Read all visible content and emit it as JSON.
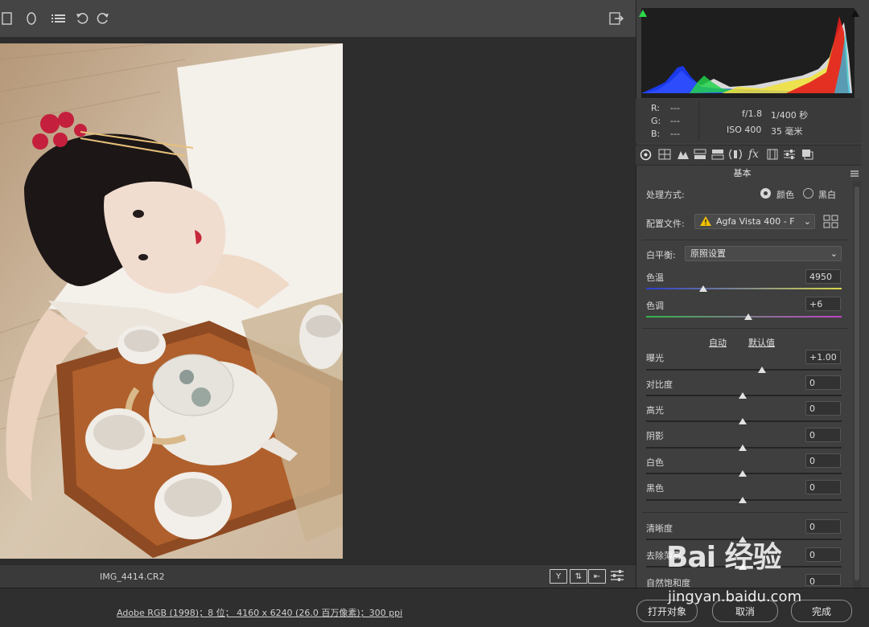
{
  "toolbar": {
    "icons": [
      "rect-icon",
      "ellipse-icon",
      "list-icon",
      "rotate-left-icon",
      "rotate-right-icon",
      "export-icon"
    ]
  },
  "preview": {
    "filename": "IMG_4414.CR2"
  },
  "info": {
    "r_label": "R:",
    "r_value": "---",
    "g_label": "G:",
    "g_value": "---",
    "b_label": "B:",
    "b_value": "---",
    "aperture": "f/1.8",
    "shutter": "1/400 秒",
    "iso": "ISO 400",
    "focal": "35 毫米"
  },
  "panel": {
    "title": "基本",
    "treatment_label": "处理方式:",
    "color_option": "颜色",
    "bw_option": "黑白",
    "profile_label": "配置文件:",
    "profile_value": "Agfa Vista 400 - F",
    "wb_label": "白平衡:",
    "wb_value": "原照设置",
    "temp_label": "色温",
    "temp_value": "4950",
    "tint_label": "色调",
    "tint_value": "+6",
    "auto_link": "自动",
    "default_link": "默认值",
    "exposure_label": "曝光",
    "exposure_value": "+1.00",
    "contrast_label": "对比度",
    "contrast_value": "0",
    "highlights_label": "高光",
    "highlights_value": "0",
    "shadows_label": "阴影",
    "shadows_value": "0",
    "whites_label": "白色",
    "whites_value": "0",
    "blacks_label": "黑色",
    "blacks_value": "0",
    "clarity_label": "清晰度",
    "clarity_value": "0",
    "dehaze_label": "去除薄雾",
    "dehaze_value": "0",
    "vibrance_label": "自然饱和度",
    "vibrance_value": "0"
  },
  "footer": {
    "workflow": "Adobe RGB (1998)；8 位； 4160 x 6240 (26.0 百万像素)；300 ppi",
    "open_button": "打开对象",
    "cancel_button": "取消",
    "done_button": "完成"
  },
  "watermark": {
    "brand": "Bai 经验",
    "url": "jingyan.baidu.com"
  }
}
